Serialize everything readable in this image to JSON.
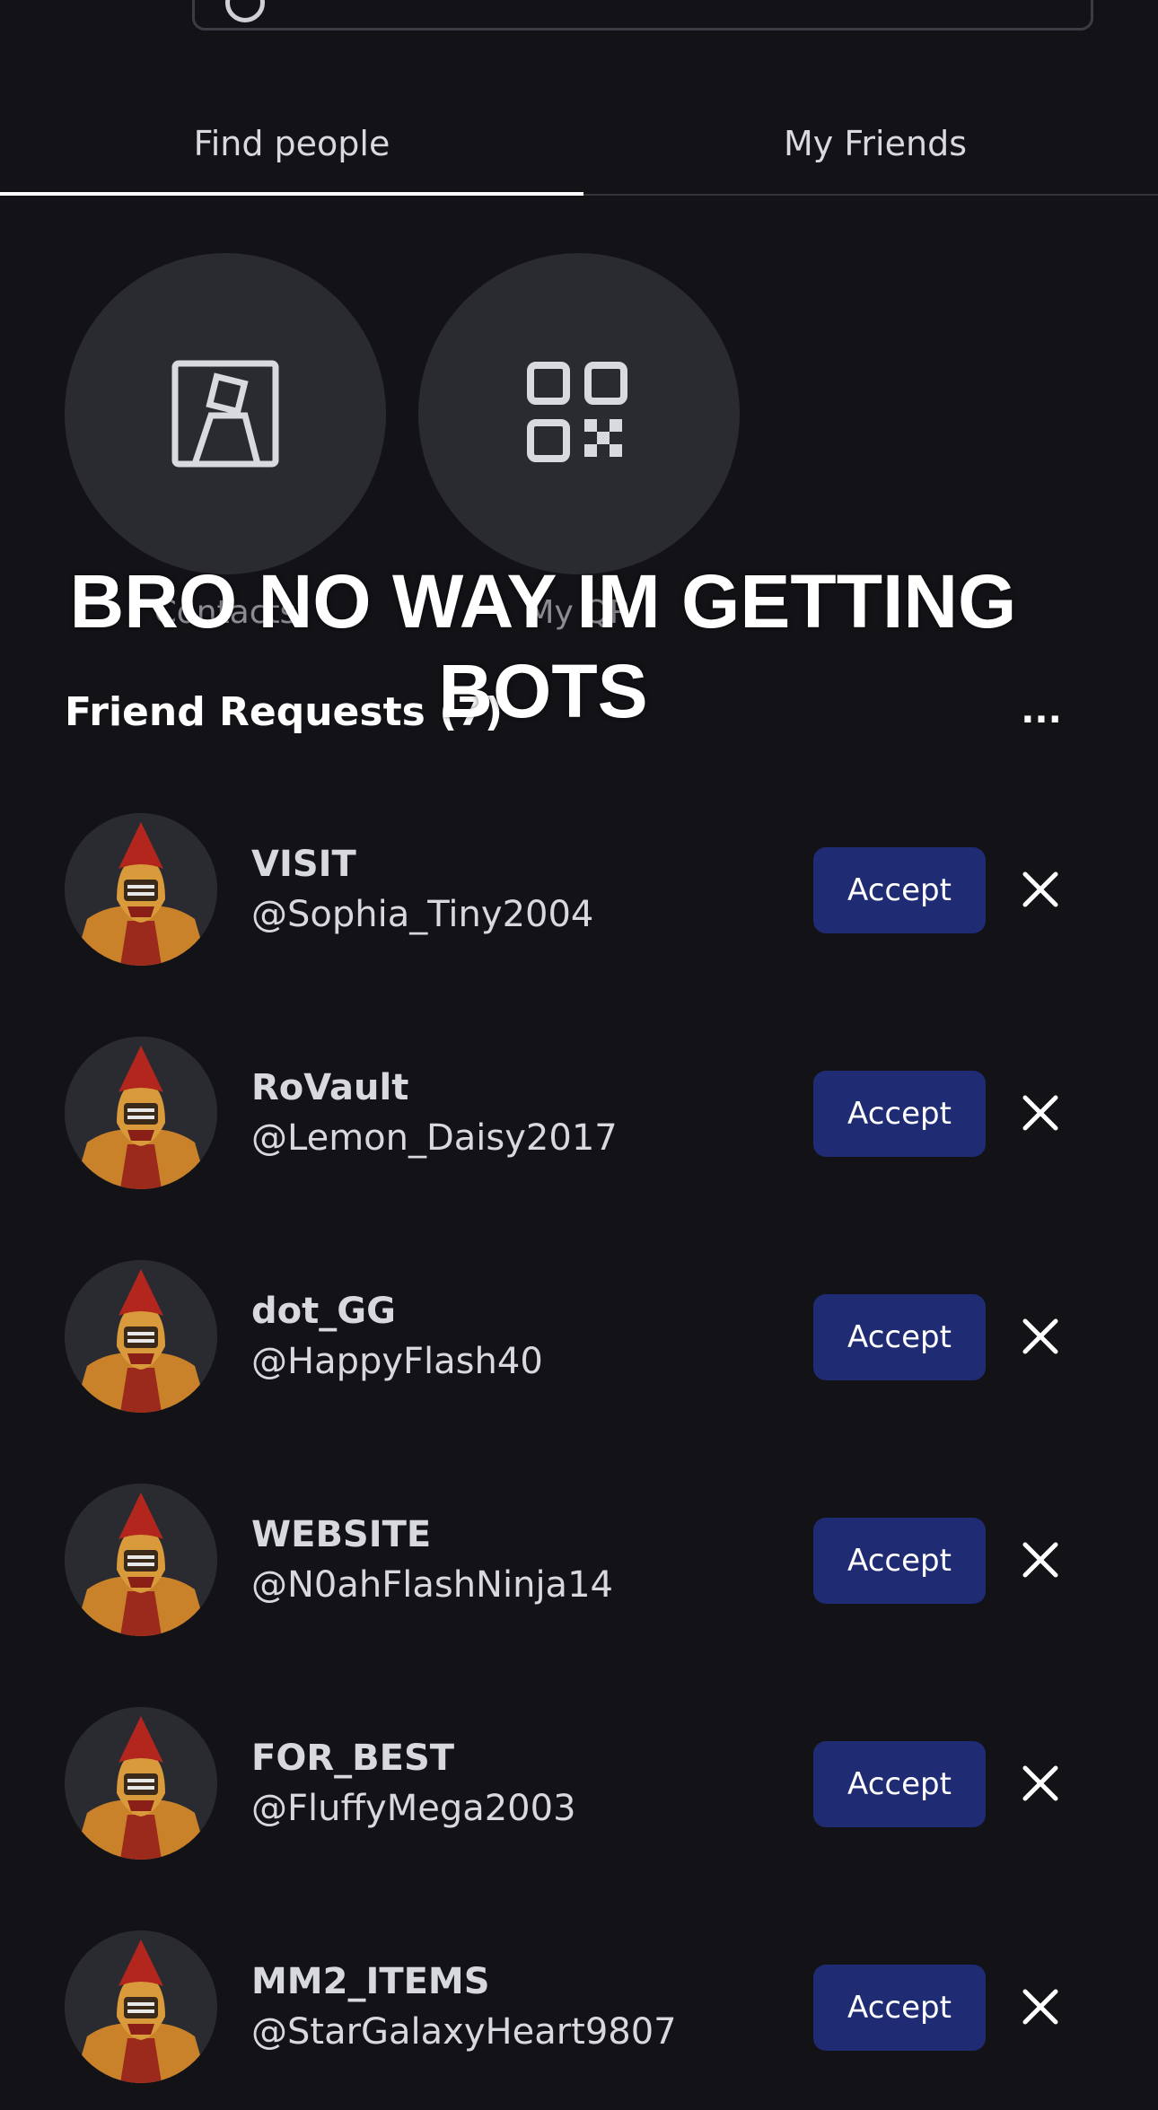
{
  "tabs": {
    "find_people": "Find people",
    "my_friends": "My Friends"
  },
  "quick_actions": {
    "contacts_label": "Contacts",
    "my_qr_label": "My QR"
  },
  "overlay_caption": "BRO NO WAY IM GETTING BOTS",
  "friend_requests": {
    "title": "Friend Requests (7)",
    "more_label": "...",
    "accept_label": "Accept",
    "items": [
      {
        "display_name": "VISIT",
        "username": "@Sophia_Tiny2004"
      },
      {
        "display_name": "RoVault",
        "username": "@Lemon_Daisy2017"
      },
      {
        "display_name": "dot_GG",
        "username": "@HappyFlash40"
      },
      {
        "display_name": "WEBSITE",
        "username": "@N0ahFlashNinja14"
      },
      {
        "display_name": "FOR_BEST",
        "username": "@FluffyMega2003"
      },
      {
        "display_name": "MM2_ITEMS",
        "username": "@StarGalaxyHeart9807"
      }
    ]
  },
  "colors": {
    "background": "#121217",
    "accept_button": "#1f2c73",
    "circle_button": "#2a2b31"
  },
  "icons": {
    "contacts": "contact-card-icon",
    "qr": "qr-code-icon",
    "decline": "close-icon",
    "search": "search-icon"
  }
}
